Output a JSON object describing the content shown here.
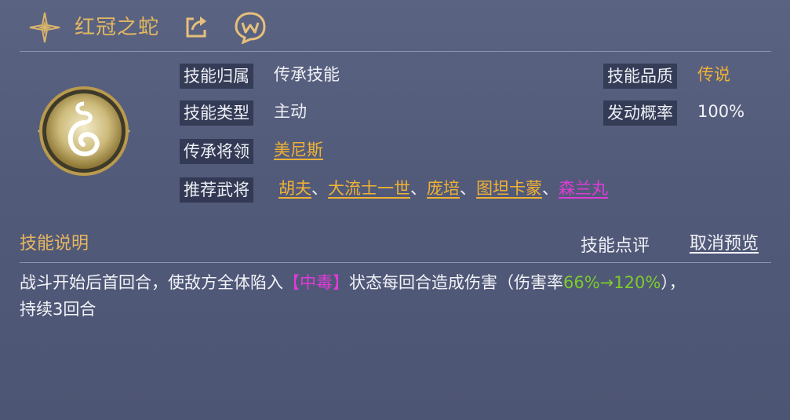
{
  "header": {
    "title": "红冠之蛇",
    "icons": [
      "sparkle-star-icon",
      "share-icon",
      "w-badge-icon"
    ]
  },
  "info": {
    "belong_label": "技能归属",
    "belong_value": "传承技能",
    "type_label": "技能类型",
    "type_value": "主动",
    "general_label": "传承将领",
    "general_value": "美尼斯",
    "recommend_label": "推荐武将",
    "recommend": [
      {
        "name": "胡夫",
        "color": "#f0b234"
      },
      {
        "name": "大流士一世",
        "color": "#f0b234"
      },
      {
        "name": "庞培",
        "color": "#f0b234"
      },
      {
        "name": "图坦卡蒙",
        "color": "#f0b234"
      },
      {
        "name": "森兰丸",
        "color": "#e03bd8"
      }
    ],
    "separator": "、",
    "quality_label": "技能品质",
    "quality_value": "传说",
    "chance_label": "发动概率",
    "chance_value": "100%"
  },
  "section": {
    "desc_title": "技能说明",
    "review_label": "技能点评",
    "cancel_label": "取消预览"
  },
  "description": {
    "part1": "战斗开始后首回合，使敌方全体陷入",
    "status": "【中毒】",
    "part2": "状态每回合造成伤害（伤害率",
    "rate": "66%→120%",
    "part3": "），",
    "part4": "持续3回合"
  },
  "colors": {
    "gold": "#f0b234",
    "title_gold": "#e2b85f",
    "pink": "#e03bd8",
    "green": "#7ccc2a"
  }
}
